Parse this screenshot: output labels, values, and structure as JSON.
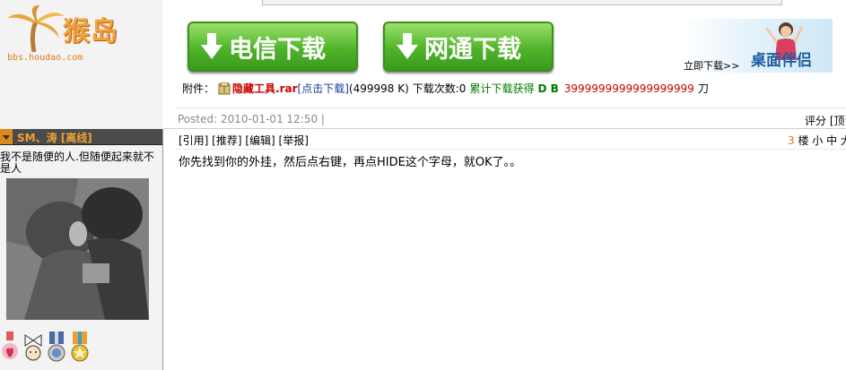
{
  "logo": {
    "text": "猴岛",
    "url": "bbs.houdao.com"
  },
  "download": {
    "telecom_label": "电信下载",
    "netcom_label": "网通下载"
  },
  "ad": {
    "title": "桌面伴侣",
    "link": "立即下载>>"
  },
  "attachment": {
    "label": "附件：",
    "filename": "隐藏工具.rar",
    "click_label": "[点击下载]",
    "size": "(499998 K)",
    "download_count": "下载次数:0",
    "earn_label": "累计下载获得",
    "currency": "D B",
    "amount": "3999999999999999999",
    "unit": "刀"
  },
  "post": {
    "posted": "Posted: 2010-01-01 12:50 |",
    "rate": "评分 [顶",
    "actions": "[引用] [推荐] [编辑] [举报]",
    "floor_num": "3",
    "floor_label": "楼 小 中 大",
    "content": "你先找到你的外挂，然后点右键，再点HIDE这个字母，就OK了。。"
  },
  "user": {
    "name": "SM、涛 [离线]",
    "signature": "我不是随便的人.但随便起来就不是人"
  },
  "colors": {
    "orange": "#e07a1a",
    "green": "#4fb42a",
    "red": "#cc0000",
    "blue": "#1a3c9c"
  }
}
